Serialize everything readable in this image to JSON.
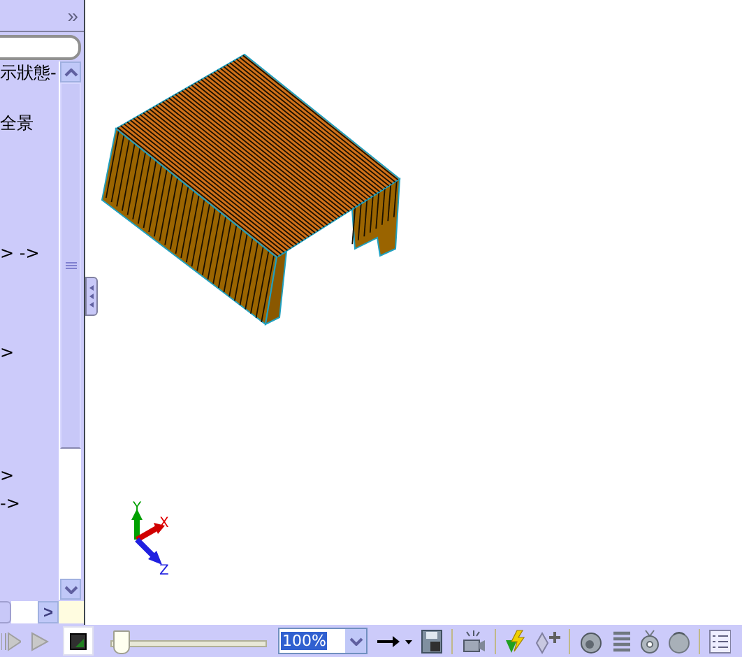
{
  "panel": {
    "expand_label": "»",
    "tree_items": [
      {
        "label": "示狀態-"
      },
      {
        "label": "全景"
      },
      {
        "label": "> ->"
      },
      {
        "label": ">"
      },
      {
        "label": ">"
      },
      {
        "label": "->"
      }
    ],
    "scroll_label": ">"
  },
  "viewport": {
    "triad": {
      "labels": [
        {
          "text": "Y"
        },
        {
          "text": "X"
        },
        {
          "text": "Z"
        }
      ]
    }
  },
  "toolbar": {
    "timeline": {
      "level": 0.02
    },
    "zoom": {
      "value": "100%"
    }
  }
}
